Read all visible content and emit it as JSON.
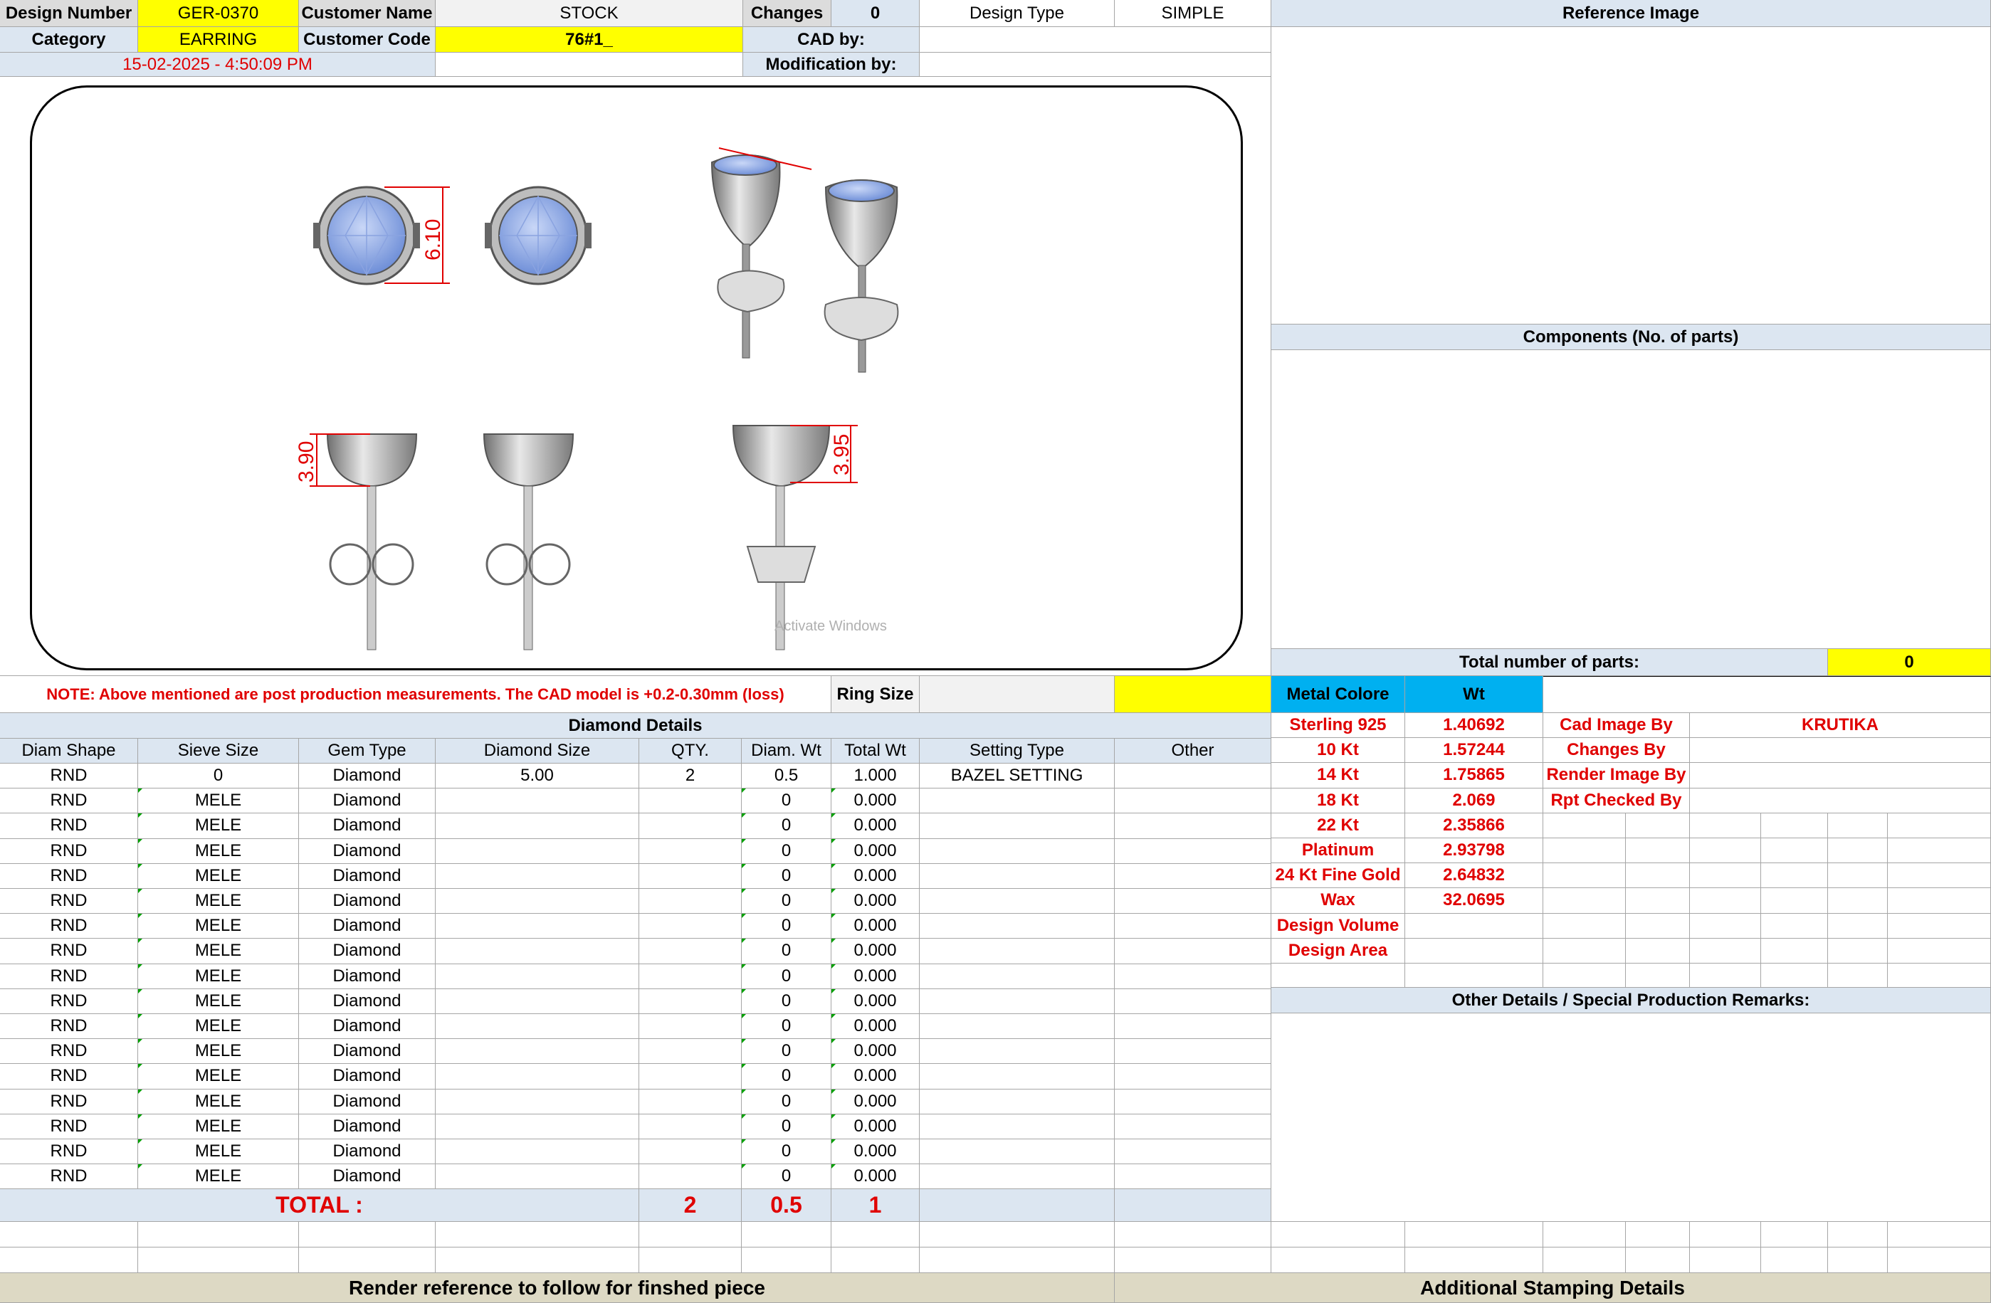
{
  "header": {
    "design_number_label": "Design Number",
    "design_number": "GER-0370",
    "customer_name_label": "Customer Name",
    "customer_name": "STOCK",
    "changes_label": "Changes",
    "changes": "0",
    "design_type_label": "Design Type",
    "design_type": "SIMPLE",
    "reference_image_label": "Reference Image",
    "category_label": "Category",
    "category": "EARRING",
    "customer_code_label": "Customer Code",
    "customer_code": "76#1_",
    "cad_by_label": "CAD by:",
    "cad_by": "",
    "timestamp": "15-02-2025 - 4:50:09 PM",
    "modification_by_label": "Modification by:",
    "modification_by": ""
  },
  "drawing": {
    "dim_front": "6.10",
    "dim_side_left": "3.90",
    "dim_side_right": "3.95",
    "watermark": "Activate Windows"
  },
  "right_panel": {
    "components_label": "Components (No. of parts)",
    "total_parts_label": "Total number of parts:",
    "total_parts": "0",
    "metal_colore_label": "Metal Colore",
    "wt_label": "Wt",
    "metals": [
      {
        "name": "Sterling 925",
        "wt": "1.40692"
      },
      {
        "name": "10 Kt",
        "wt": "1.57244"
      },
      {
        "name": "14 Kt",
        "wt": "1.75865"
      },
      {
        "name": "18 Kt",
        "wt": "2.069"
      },
      {
        "name": "22 Kt",
        "wt": "2.35866"
      },
      {
        "name": "Platinum",
        "wt": "2.93798"
      },
      {
        "name": "24 Kt Fine Gold",
        "wt": "2.64832"
      },
      {
        "name": "Wax",
        "wt": "32.0695"
      },
      {
        "name": "Design Volume",
        "wt": ""
      },
      {
        "name": "Design Area",
        "wt": ""
      }
    ],
    "credits": [
      {
        "label": "Cad Image By",
        "value": "KRUTIKA"
      },
      {
        "label": "Changes By",
        "value": ""
      },
      {
        "label": "Render Image By",
        "value": ""
      },
      {
        "label": "Rpt Checked By",
        "value": ""
      }
    ],
    "other_details_label": "Other Details / Special Production Remarks:"
  },
  "note": "NOTE: Above mentioned are post production measurements. The CAD model is +0.2-0.30mm (loss)",
  "ring_size_label": "Ring Size",
  "ring_size": "",
  "diamond_details": {
    "title": "Diamond Details",
    "columns": [
      "Diam Shape",
      "Sieve Size",
      "Gem Type",
      "Diamond Size",
      "QTY.",
      "Diam. Wt",
      "Total Wt",
      "Setting Type",
      "Other"
    ],
    "rows": [
      [
        "RND",
        "0",
        "Diamond",
        "5.00",
        "2",
        "0.5",
        "1.000",
        "BAZEL SETTING",
        ""
      ],
      [
        "RND",
        "MELE",
        "Diamond",
        "",
        "",
        "0",
        "0.000",
        "",
        ""
      ],
      [
        "RND",
        "MELE",
        "Diamond",
        "",
        "",
        "0",
        "0.000",
        "",
        ""
      ],
      [
        "RND",
        "MELE",
        "Diamond",
        "",
        "",
        "0",
        "0.000",
        "",
        ""
      ],
      [
        "RND",
        "MELE",
        "Diamond",
        "",
        "",
        "0",
        "0.000",
        "",
        ""
      ],
      [
        "RND",
        "MELE",
        "Diamond",
        "",
        "",
        "0",
        "0.000",
        "",
        ""
      ],
      [
        "RND",
        "MELE",
        "Diamond",
        "",
        "",
        "0",
        "0.000",
        "",
        ""
      ],
      [
        "RND",
        "MELE",
        "Diamond",
        "",
        "",
        "0",
        "0.000",
        "",
        ""
      ],
      [
        "RND",
        "MELE",
        "Diamond",
        "",
        "",
        "0",
        "0.000",
        "",
        ""
      ],
      [
        "RND",
        "MELE",
        "Diamond",
        "",
        "",
        "0",
        "0.000",
        "",
        ""
      ],
      [
        "RND",
        "MELE",
        "Diamond",
        "",
        "",
        "0",
        "0.000",
        "",
        ""
      ],
      [
        "RND",
        "MELE",
        "Diamond",
        "",
        "",
        "0",
        "0.000",
        "",
        ""
      ],
      [
        "RND",
        "MELE",
        "Diamond",
        "",
        "",
        "0",
        "0.000",
        "",
        ""
      ],
      [
        "RND",
        "MELE",
        "Diamond",
        "",
        "",
        "0",
        "0.000",
        "",
        ""
      ],
      [
        "RND",
        "MELE",
        "Diamond",
        "",
        "",
        "0",
        "0.000",
        "",
        ""
      ],
      [
        "RND",
        "MELE",
        "Diamond",
        "",
        "",
        "0",
        "0.000",
        "",
        ""
      ],
      [
        "RND",
        "MELE",
        "Diamond",
        "",
        "",
        "0",
        "0.000",
        "",
        ""
      ]
    ],
    "total_label": "TOTAL :",
    "total_qty": "2",
    "total_diam_wt": "0.5",
    "total_wt": "1"
  },
  "footer": {
    "render_reference": "Render reference to follow for finshed piece",
    "additional_stamping": "Additional Stamping Details"
  },
  "colors": {
    "yellow": "#ffff00",
    "light_blue": "#dce6f1",
    "cyan": "#00b0f0",
    "red": "#e00000",
    "tan": "#ddd9c4"
  }
}
